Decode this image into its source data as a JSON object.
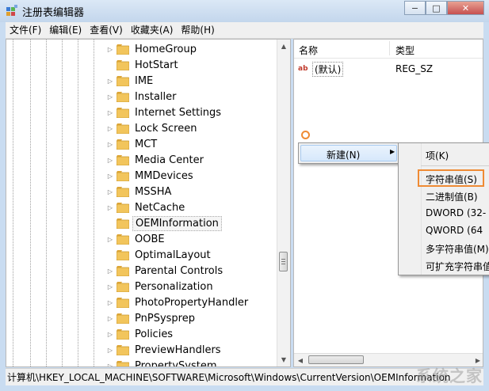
{
  "window": {
    "title": "注册表编辑器",
    "min": "−",
    "max": "□",
    "close": "✕"
  },
  "menu": [
    "文件(F)",
    "编辑(E)",
    "查看(V)",
    "收藏夹(A)",
    "帮助(H)"
  ],
  "tree": {
    "items": [
      {
        "label": "HomeGroup",
        "expandable": true
      },
      {
        "label": "HotStart",
        "expandable": false
      },
      {
        "label": "IME",
        "expandable": true
      },
      {
        "label": "Installer",
        "expandable": true
      },
      {
        "label": "Internet Settings",
        "expandable": true
      },
      {
        "label": "Lock Screen",
        "expandable": true
      },
      {
        "label": "MCT",
        "expandable": true
      },
      {
        "label": "Media Center",
        "expandable": true
      },
      {
        "label": "MMDevices",
        "expandable": true
      },
      {
        "label": "MSSHA",
        "expandable": true
      },
      {
        "label": "NetCache",
        "expandable": true
      },
      {
        "label": "OEMInformation",
        "expandable": false,
        "selected": true
      },
      {
        "label": "OOBE",
        "expandable": true
      },
      {
        "label": "OptimalLayout",
        "expandable": false
      },
      {
        "label": "Parental Controls",
        "expandable": true
      },
      {
        "label": "Personalization",
        "expandable": true
      },
      {
        "label": "PhotoPropertyHandler",
        "expandable": true
      },
      {
        "label": "PnPSysprep",
        "expandable": true
      },
      {
        "label": "Policies",
        "expandable": true
      },
      {
        "label": "PreviewHandlers",
        "expandable": true
      },
      {
        "label": "PropertySystem",
        "expandable": true
      }
    ]
  },
  "list": {
    "headers": {
      "name": "名称",
      "type": "类型"
    },
    "rows": [
      {
        "icon": "ab",
        "name": "(默认)",
        "type": "REG_SZ"
      }
    ]
  },
  "context_menu": {
    "new_label": "新建(N)"
  },
  "submenu": {
    "items": [
      "项(K)",
      "字符串值(S)",
      "二进制值(B)",
      "DWORD (32-",
      "QWORD (64",
      "多字符串值(M)",
      "可扩充字符串值"
    ],
    "highlighted": "字符串值(S)"
  },
  "statusbar": {
    "path": "计算机\\HKEY_LOCAL_MACHINE\\SOFTWARE\\Microsoft\\Windows\\CurrentVersion\\OEMInformation"
  },
  "watermark": "系统之家",
  "colors": {
    "accent": "#ef8b34",
    "title_bg": "#c9dcf1",
    "close": "#c75050",
    "folder": "#f2c55c"
  }
}
